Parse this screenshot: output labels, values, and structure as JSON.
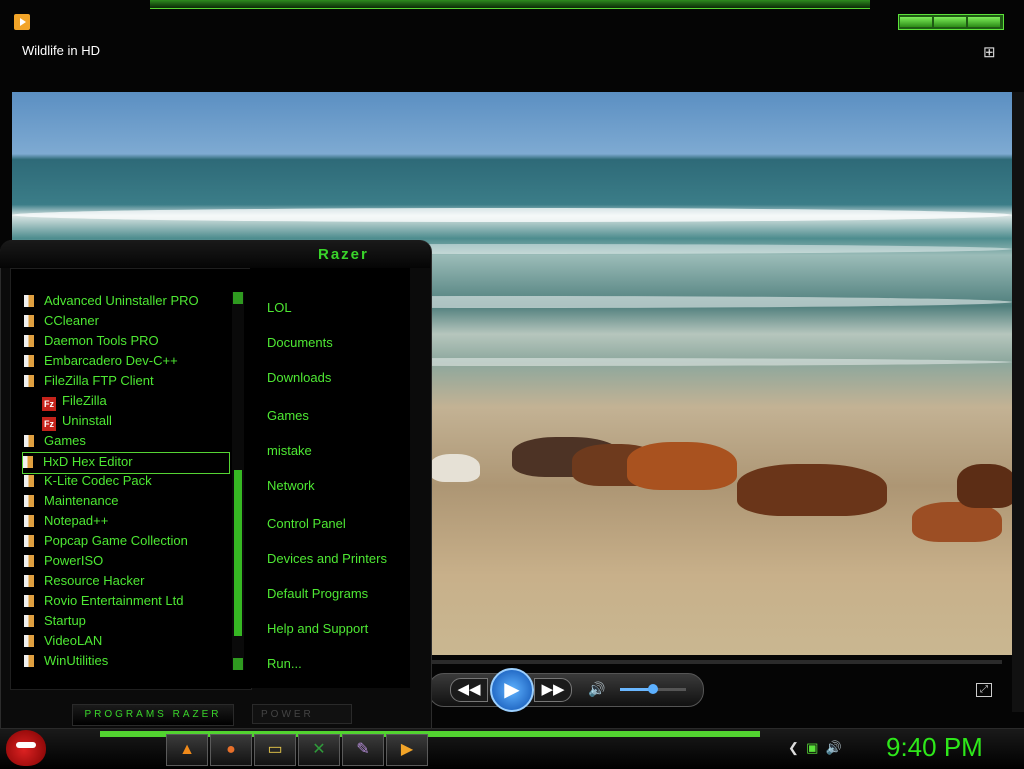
{
  "window": {
    "title": "Wildlife in HD"
  },
  "icons": {
    "app": "media-player-icon",
    "switch_view": "switch-to-library-icon",
    "rewind": "rewind-icon",
    "play": "play-icon",
    "forward": "fast-forward-icon",
    "mute": "speaker-icon",
    "fullscreen": "fullscreen-icon"
  },
  "player": {
    "volume_level": 0.45
  },
  "start_menu": {
    "brand": "Razer",
    "programs": [
      {
        "label": "Advanced Uninstaller PRO",
        "type": "folder"
      },
      {
        "label": "CCleaner",
        "type": "folder"
      },
      {
        "label": "Daemon Tools PRO",
        "type": "folder"
      },
      {
        "label": "Embarcadero Dev-C++",
        "type": "folder"
      },
      {
        "label": "FileZilla FTP Client",
        "type": "folder"
      },
      {
        "label": "FileZilla",
        "type": "app"
      },
      {
        "label": "Uninstall",
        "type": "app"
      },
      {
        "label": "Games",
        "type": "folder"
      },
      {
        "label": "HxD Hex Editor",
        "type": "folder",
        "highlighted": true
      },
      {
        "label": "K-Lite Codec Pack",
        "type": "folder"
      },
      {
        "label": "Maintenance",
        "type": "folder"
      },
      {
        "label": "Notepad++",
        "type": "folder"
      },
      {
        "label": "Popcap Game Collection",
        "type": "folder"
      },
      {
        "label": "PowerISO",
        "type": "folder"
      },
      {
        "label": "Resource Hacker",
        "type": "folder"
      },
      {
        "label": "Rovio Entertainment Ltd",
        "type": "folder"
      },
      {
        "label": "Startup",
        "type": "folder"
      },
      {
        "label": "VideoLAN",
        "type": "folder"
      },
      {
        "label": "WinUtilities",
        "type": "folder"
      }
    ],
    "links": [
      "LOL",
      "Documents",
      "Downloads",
      "Games",
      "mistake",
      "Network",
      "Control Panel",
      "Devices and Printers",
      "Default Programs",
      "Help and Support",
      "Run..."
    ],
    "programs_button": "PROGRAMS RAZER",
    "power_button": "POWER"
  },
  "taskbar": {
    "pinned": [
      "vlc-icon",
      "firefox-icon",
      "folder-icon",
      "excel-icon",
      "paint-icon",
      "media-player-icon"
    ],
    "clock": "9:40 PM"
  }
}
